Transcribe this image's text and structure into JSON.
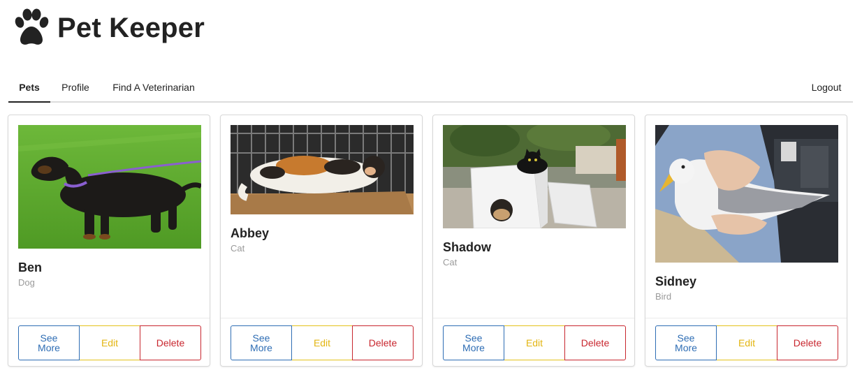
{
  "app": {
    "title": "Pet Keeper",
    "logo_icon": "paw-icon"
  },
  "nav": {
    "tabs": [
      {
        "label": "Pets",
        "active": true
      },
      {
        "label": "Profile",
        "active": false
      },
      {
        "label": "Find A Veterinarian",
        "active": false
      }
    ],
    "logout_label": "Logout"
  },
  "pets": [
    {
      "name": "Ben",
      "type": "Dog",
      "photo": "dachshund-photo"
    },
    {
      "name": "Abbey",
      "type": "Cat",
      "photo": "calico-cat-photo"
    },
    {
      "name": "Shadow",
      "type": "Cat",
      "photo": "black-cat-photo"
    },
    {
      "name": "Sidney",
      "type": "Bird",
      "photo": "seagull-photo"
    }
  ],
  "actions": {
    "see_more_label": "See More",
    "edit_label": "Edit",
    "delete_label": "Delete"
  },
  "colors": {
    "see_more": "#2e6db4",
    "edit": "#e3b511",
    "delete": "#c8262e",
    "muted_text": "#9a9a9a"
  }
}
